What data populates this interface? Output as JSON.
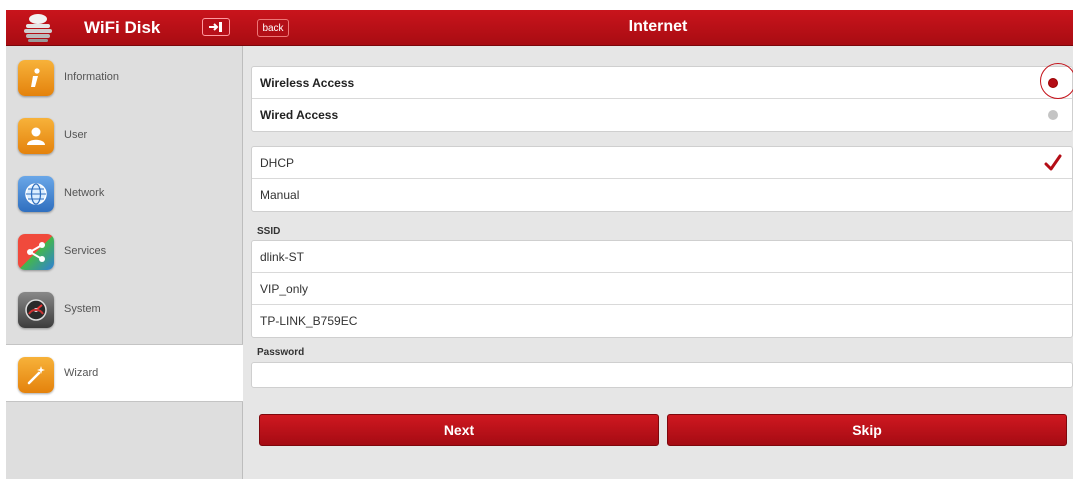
{
  "sidebar": {
    "app_title": "WiFi Disk",
    "logo_icon": "disk-stack-icon",
    "logout_icon": "logout-icon",
    "items": [
      {
        "label": "Information",
        "icon": "info-icon"
      },
      {
        "label": "User",
        "icon": "user-icon"
      },
      {
        "label": "Network",
        "icon": "globe-icon"
      },
      {
        "label": "Services",
        "icon": "share-icon"
      },
      {
        "label": "System",
        "icon": "gauge-icon"
      },
      {
        "label": "Wizard",
        "icon": "wand-icon",
        "active": true
      }
    ]
  },
  "header": {
    "back_label": "back",
    "title": "Internet"
  },
  "access": {
    "options": [
      {
        "label": "Wireless Access",
        "selected": true
      },
      {
        "label": "Wired Access",
        "selected": false
      }
    ]
  },
  "ip_mode": {
    "options": [
      {
        "label": "DHCP",
        "checked": true
      },
      {
        "label": "Manual",
        "checked": false
      }
    ]
  },
  "ssid": {
    "label": "SSID",
    "networks": [
      "dlink-ST",
      "VIP_only",
      "TP-LINK_B759EC"
    ]
  },
  "password": {
    "label": "Password",
    "value": ""
  },
  "actions": {
    "next_label": "Next",
    "skip_label": "Skip"
  },
  "colors": {
    "accent": "#b40d16",
    "header_red": "#c9141c",
    "sidebar_bg": "#dedede",
    "main_bg": "#e6e6e6"
  }
}
